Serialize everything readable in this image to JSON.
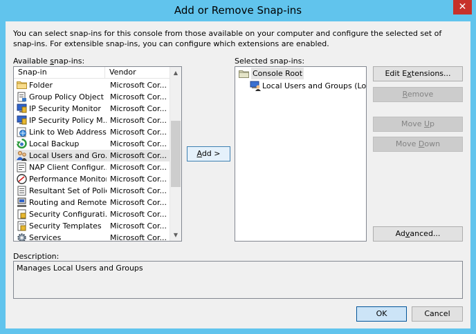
{
  "window": {
    "title": "Add or Remove Snap-ins",
    "close_glyph": "✕"
  },
  "intro": "You can select snap-ins for this console from those available on your computer and configure the selected set of snap-ins. For extensible snap-ins, you can configure which extensions are enabled.",
  "available": {
    "label_pre": "Available ",
    "label_u": "s",
    "label_post": "nap-ins:",
    "columns": {
      "snapin": "Snap-in",
      "vendor": "Vendor"
    },
    "items": [
      {
        "name": "Folder",
        "vendor": "Microsoft Cor...",
        "icon": "folder-icon"
      },
      {
        "name": "Group Policy Object ...",
        "vendor": "Microsoft Cor...",
        "icon": "group-policy-icon"
      },
      {
        "name": "IP Security Monitor",
        "vendor": "Microsoft Cor...",
        "icon": "ip-security-monitor-icon"
      },
      {
        "name": "IP Security Policy M...",
        "vendor": "Microsoft Cor...",
        "icon": "ip-security-policy-icon"
      },
      {
        "name": "Link to Web Address",
        "vendor": "Microsoft Cor...",
        "icon": "web-link-icon"
      },
      {
        "name": "Local Backup",
        "vendor": "Microsoft Cor...",
        "icon": "backup-icon"
      },
      {
        "name": "Local Users and Gro...",
        "vendor": "Microsoft Cor...",
        "icon": "users-icon"
      },
      {
        "name": "NAP Client Configur...",
        "vendor": "Microsoft Cor...",
        "icon": "nap-client-icon"
      },
      {
        "name": "Performance Monitor",
        "vendor": "Microsoft Cor...",
        "icon": "performance-monitor-icon"
      },
      {
        "name": "Resultant Set of Policy",
        "vendor": "Microsoft Cor...",
        "icon": "resultant-policy-icon"
      },
      {
        "name": "Routing and Remote...",
        "vendor": "Microsoft Cor...",
        "icon": "routing-icon"
      },
      {
        "name": "Security Configurati...",
        "vendor": "Microsoft Cor...",
        "icon": "security-config-icon"
      },
      {
        "name": "Security Templates",
        "vendor": "Microsoft Cor...",
        "icon": "security-templates-icon"
      },
      {
        "name": "Services",
        "vendor": "Microsoft Cor...",
        "icon": "services-gear-icon"
      }
    ],
    "selected_index": 6
  },
  "add_button": {
    "u": "A",
    "rest": "dd >"
  },
  "selected": {
    "label_pre": "Selected snap-ins:",
    "root": "Console Root",
    "child": "Local Users and Groups (Local)"
  },
  "buttons": {
    "edit_extensions": {
      "pre": "Edit E",
      "u": "x",
      "post": "tensions..."
    },
    "remove": {
      "pre": "",
      "u": "R",
      "post": "emove"
    },
    "move_up": {
      "pre": "Move ",
      "u": "U",
      "post": "p"
    },
    "move_down": {
      "pre": "Move ",
      "u": "D",
      "post": "own"
    },
    "advanced": {
      "pre": "Ad",
      "u": "v",
      "post": "anced..."
    },
    "ok": "OK",
    "cancel": "Cancel"
  },
  "description": {
    "label": "Description:",
    "text": "Manages Local Users and Groups"
  },
  "colors": {
    "title_bg": "#61c4ed",
    "close_bg": "#c7312a",
    "selection": "#e5e5e5"
  }
}
